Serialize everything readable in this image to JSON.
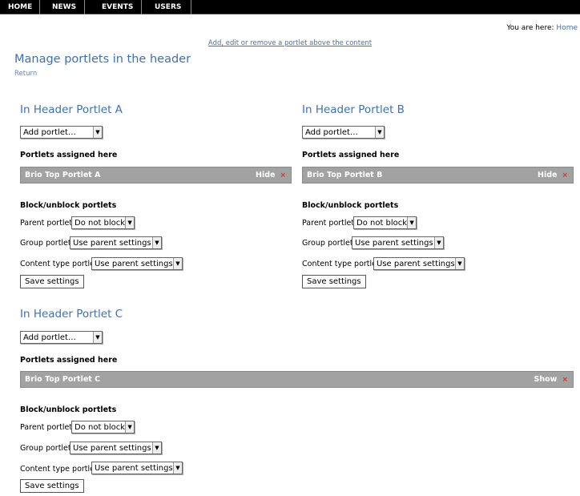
{
  "nav": {
    "items": [
      {
        "label": "HOME"
      },
      {
        "label": "NEWS"
      },
      {
        "label": "EVENTS"
      },
      {
        "label": "USERS"
      }
    ]
  },
  "breadcrumb": {
    "label": "You are here:",
    "home": "Home"
  },
  "above_link": "Add, edit or remove a portlet above the content",
  "page": {
    "title": "Manage portlets in the header",
    "return": "Return"
  },
  "portlets": [
    {
      "title": "In Header Portlet A",
      "add_select": "Add portlet…",
      "assigned_label": "Portlets assigned here",
      "assigned": {
        "name": "Brio Top Portlet A",
        "action": "Hide",
        "close": "×"
      },
      "block_label": "Block/unblock portlets",
      "parent_label": "Parent portlets:",
      "parent_value": "Do not block",
      "group_label": "Group portlets:",
      "group_value": "Use parent settings",
      "ctype_label": "Content type portlets:",
      "ctype_value": "Use parent settings",
      "save": "Save settings"
    },
    {
      "title": "In Header Portlet B",
      "add_select": "Add portlet…",
      "assigned_label": "Portlets assigned here",
      "assigned": {
        "name": "Brio Top Portlet B",
        "action": "Hide",
        "close": "×"
      },
      "block_label": "Block/unblock portlets",
      "parent_label": "Parent portlets:",
      "parent_value": "Do not block",
      "group_label": "Group portlets:",
      "group_value": "Use parent settings",
      "ctype_label": "Content type portlets:",
      "ctype_value": "Use parent settings",
      "save": "Save settings"
    },
    {
      "title": "In Header Portlet C",
      "add_select": "Add portlet…",
      "assigned_label": "Portlets assigned here",
      "assigned": {
        "name": "Brio Top Portlet C",
        "action": "Show",
        "close": "×"
      },
      "block_label": "Block/unblock portlets",
      "parent_label": "Parent portlets:",
      "parent_value": "Do not block",
      "group_label": "Group portlets:",
      "group_value": "Use parent settings",
      "ctype_label": "Content type portlets:",
      "ctype_value": "Use parent settings",
      "save": "Save settings"
    }
  ],
  "colors": {
    "link": "#3b70bf",
    "bar": "#a2a2a2",
    "nav_bg": "#000000"
  }
}
